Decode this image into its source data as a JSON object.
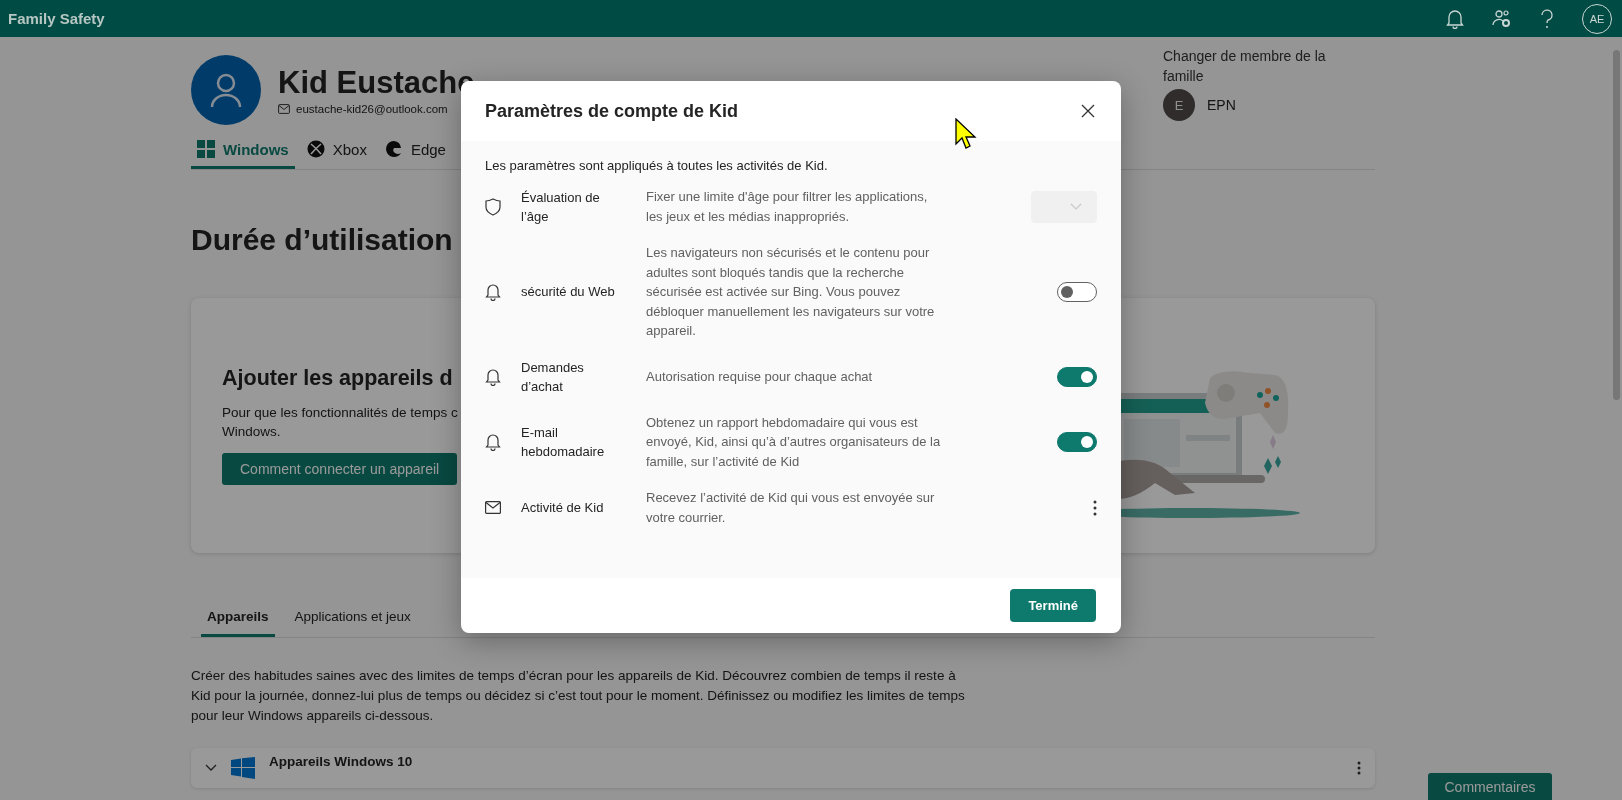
{
  "top_bar": {
    "title": "Family Safety",
    "avatar_initials": "AE"
  },
  "profile": {
    "name": "Kid Eustache",
    "email": "eustache-kid26@outlook.com"
  },
  "platform_tabs": [
    {
      "label": "Windows",
      "selected": true,
      "kind": "windows"
    },
    {
      "label": "Xbox",
      "selected": false,
      "kind": "xbox"
    },
    {
      "label": "Edge",
      "selected": false,
      "kind": "edge"
    }
  ],
  "member_switch": {
    "label": "Changer de membre de la famille",
    "initial": "E",
    "name": "EPN"
  },
  "page_title": "Durée d’utilisation",
  "devices_card": {
    "title": "Ajouter les appareils d",
    "text_lines": [
      "Pour que les fonctionnalités de temps c",
      "Windows."
    ],
    "button": "Comment connecter un appareil"
  },
  "section_tabs": [
    {
      "label": "Appareils",
      "selected": true
    },
    {
      "label": "Applications et jeux",
      "selected": false
    }
  ],
  "description": "Créer des habitudes saines avec des limites de temps d’écran pour les appareils de Kid. Découvrez combien de temps il reste à Kid pour la journée, donnez-lui plus de temps ou décidez si c’est tout pour le moment. Définissez ou modifiez les limites de temps pour leur Windows appareils ci-dessous.",
  "device_group": {
    "title": "Appareils Windows 10"
  },
  "feedback_button": "Commentaires",
  "dialog": {
    "title": "Paramètres de compte de Kid",
    "intro": "Les paramètres sont appliqués à toutes les activités de Kid.",
    "settings": [
      {
        "kind": "dropdown",
        "label": "Évaluation de l’âge",
        "description": "Fixer une limite d'âge pour filtrer les applications, les jeux et les médias inappropriés.",
        "disabled": true
      },
      {
        "kind": "toggle",
        "label": "sécurité du Web",
        "description": "Les navigateurs non sécurisés et le contenu pour adultes sont bloqués tandis que la recherche sécurisée est activée sur Bing. Vous pouvez débloquer manuellement les navigateurs sur votre appareil.",
        "on": false
      },
      {
        "kind": "toggle",
        "label": "Demandes d’achat",
        "description": "Autorisation requise pour chaque achat",
        "on": true
      },
      {
        "kind": "toggle",
        "label": "E-mail hebdomadaire",
        "description": "Obtenez un rapport hebdomadaire qui vous est envoyé, Kid, ainsi qu’à d’autres organisateurs de la famille, sur l’activité de Kid",
        "on": true
      },
      {
        "kind": "menu",
        "label": "Activité de Kid",
        "description": "Recevez l’activité de Kid qui vous est envoyée sur votre courrier."
      }
    ],
    "done_button": "Terminé"
  }
}
